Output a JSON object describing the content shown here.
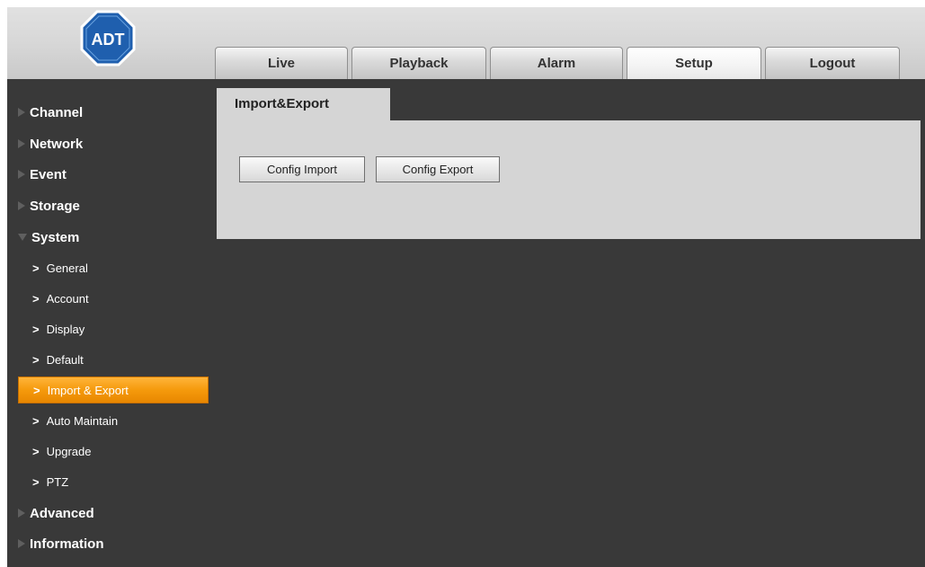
{
  "logo": {
    "text": "ADT",
    "color": "#2e6fb8"
  },
  "nav": {
    "tabs": [
      {
        "label": "Live"
      },
      {
        "label": "Playback"
      },
      {
        "label": "Alarm"
      },
      {
        "label": "Setup",
        "active": true
      },
      {
        "label": "Logout"
      }
    ]
  },
  "sidebar": {
    "menu": [
      {
        "label": "Channel"
      },
      {
        "label": "Network"
      },
      {
        "label": "Event"
      },
      {
        "label": "Storage"
      },
      {
        "label": "System",
        "expanded": true
      },
      {
        "label": "Advanced"
      },
      {
        "label": "Information"
      }
    ],
    "system_items": [
      {
        "label": "General"
      },
      {
        "label": "Account"
      },
      {
        "label": "Display"
      },
      {
        "label": "Default"
      },
      {
        "label": "Import & Export",
        "active": true
      },
      {
        "label": "Auto Maintain"
      },
      {
        "label": "Upgrade"
      },
      {
        "label": "PTZ"
      }
    ],
    "chevron": ">"
  },
  "main": {
    "tab_label": "Import&Export",
    "buttons": {
      "import_label": "Config Import",
      "export_label": "Config Export"
    }
  },
  "colors": {
    "background": "#393939",
    "panel": "#d5d5d5",
    "accent": "#f59a0c"
  }
}
